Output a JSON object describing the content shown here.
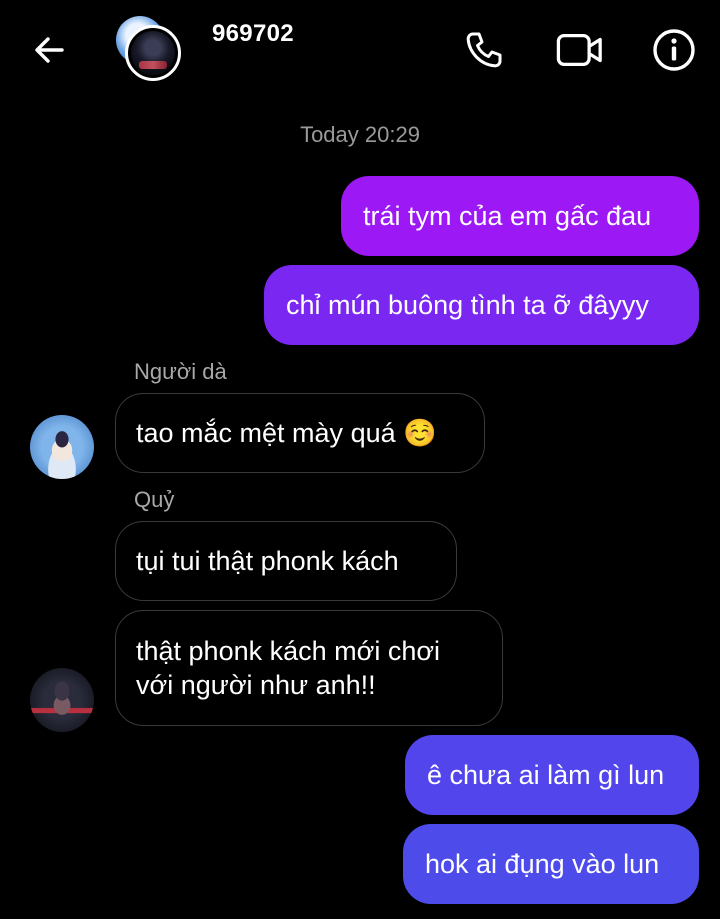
{
  "header": {
    "title": "969702",
    "icons": [
      "back-arrow-icon",
      "phone-icon",
      "video-camera-icon",
      "info-icon"
    ]
  },
  "timestamp": "Today 20:29",
  "messages": [
    {
      "text": "trái tym của em gấc đau"
    },
    {
      "text": "chỉ mún buông tình ta ỡ đâyyy"
    },
    {
      "sender": "Người dà",
      "text": "tao mắc mệt mày quá ☺️"
    },
    {
      "sender": "Quỷ",
      "text": "tụi tui thật phonk kách"
    },
    {
      "text_line1": "thật phonk kách mới chơi",
      "text_line2": "với người như anh!!"
    },
    {
      "text": "ê chưa ai làm gì lun"
    },
    {
      "text": "hok ai đụng vào lun"
    }
  ],
  "colors": {
    "outgoing_purple": "#9c18f5",
    "outgoing_violet": "#7a27f2",
    "outgoing_indigo": "#5245ec",
    "outgoing_blue": "#4d4cea",
    "incoming_border": "#3a3a3a",
    "background": "#000000",
    "muted_text": "#9a9a9a"
  }
}
